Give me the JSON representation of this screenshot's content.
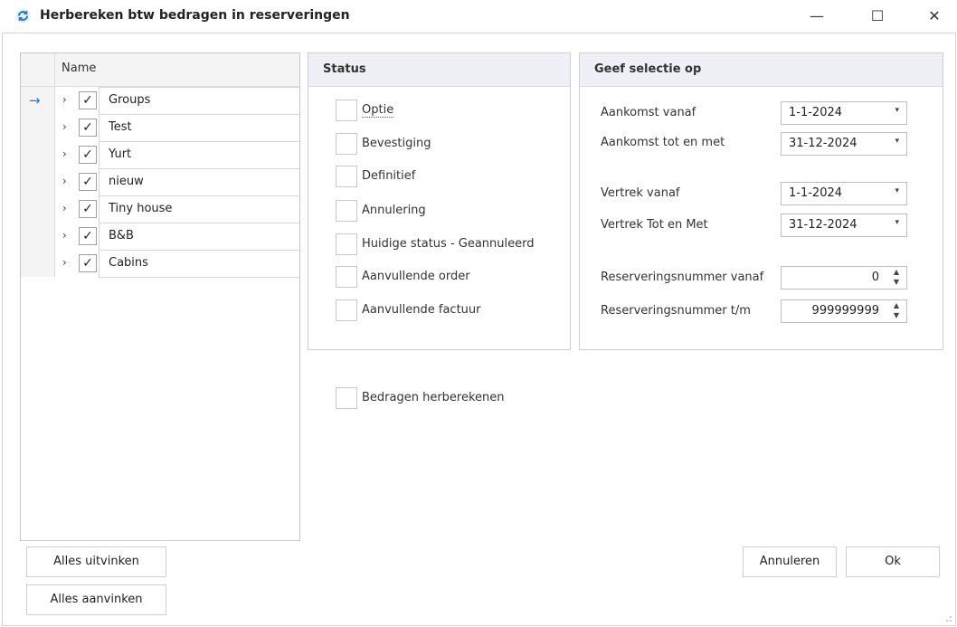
{
  "window": {
    "title": "Herbereken btw bedragen in reserveringen",
    "controls": {
      "minimize": "—",
      "maximize": "☐",
      "close": "✕"
    }
  },
  "tree": {
    "header": "Name",
    "current_indicator": "→",
    "rows": [
      {
        "label": "Groups",
        "checked": true
      },
      {
        "label": "Test",
        "checked": true
      },
      {
        "label": "Yurt",
        "checked": true
      },
      {
        "label": "nieuw",
        "checked": true
      },
      {
        "label": "Tiny house",
        "checked": true
      },
      {
        "label": "B&B",
        "checked": true
      },
      {
        "label": "Cabins",
        "checked": true
      }
    ],
    "expander_glyph": "›",
    "check_glyph": "✓"
  },
  "status": {
    "title": "Status",
    "options": [
      {
        "label": "Optie",
        "checked": false
      },
      {
        "label": "Bevestiging",
        "checked": false
      },
      {
        "label": "Definitief",
        "checked": false
      },
      {
        "label": "Annulering",
        "checked": false
      },
      {
        "label": "Huidige status - Geannuleerd",
        "checked": false
      },
      {
        "label": "Aanvullende order",
        "checked": false
      },
      {
        "label": "Aanvullende factuur",
        "checked": false
      }
    ]
  },
  "recalc": {
    "label": "Bedragen herberekenen",
    "checked": false
  },
  "selection": {
    "title": "Geef selectie op",
    "arrival_from": {
      "label": "Aankomst vanaf",
      "value": "1-1-2024"
    },
    "arrival_to": {
      "label": "Aankomst tot en met",
      "value": "31-12-2024"
    },
    "departure_from": {
      "label": "Vertrek vanaf",
      "value": "1-1-2024"
    },
    "departure_to": {
      "label": "Vertrek Tot en Met",
      "value": "31-12-2024"
    },
    "resnr_from": {
      "label": "Reserveringsnummer vanaf",
      "value": "0"
    },
    "resnr_to": {
      "label": "Reserveringsnummer t/m",
      "value": "999999999"
    },
    "dropdown_glyph": "▾",
    "spin_glyph": "▲\n▼"
  },
  "buttons": {
    "uncheck_all": "Alles uitvinken",
    "check_all": "Alles aanvinken",
    "cancel": "Annuleren",
    "ok": "Ok"
  },
  "colors": {
    "accent": "#1e7fd6",
    "header_bg": "#eef0f5"
  }
}
